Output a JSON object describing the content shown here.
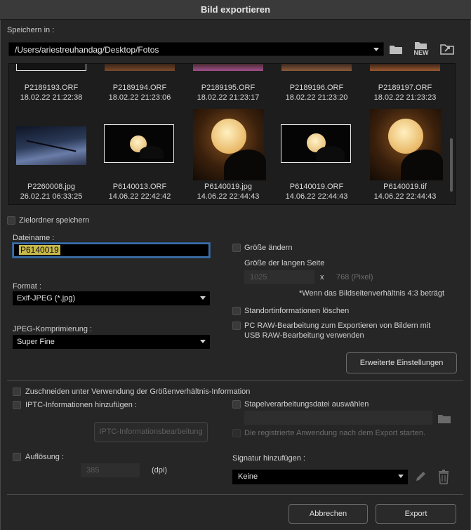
{
  "window": {
    "title": "Bild exportieren"
  },
  "save_in": {
    "label": "Speichern in :",
    "path": "/Users/ariestreuhandag/Desktop/Fotos",
    "new_label": "NEW"
  },
  "thumbnails_top": [
    {
      "name": "P2189193.ORF",
      "date": "18.02.22 21:22:38"
    },
    {
      "name": "P2189194.ORF",
      "date": "18.02.22 21:23:06"
    },
    {
      "name": "P2189195.ORF",
      "date": "18.02.22 21:23:17"
    },
    {
      "name": "P2189196.ORF",
      "date": "18.02.22 21:23:20"
    },
    {
      "name": "P2189197.ORF",
      "date": "18.02.22 21:23:23"
    }
  ],
  "thumbnails_bottom": [
    {
      "name": "P2260008.jpg",
      "date": "26.02.21 06:33:25"
    },
    {
      "name": "P6140013.ORF",
      "date": "14.06.22 22:42:42"
    },
    {
      "name": "P6140019.jpg",
      "date": "14.06.22 22:44:43"
    },
    {
      "name": "P6140019.ORF",
      "date": "14.06.22 22:44:43"
    },
    {
      "name": "P6140019.tif",
      "date": "14.06.22 22:44:43"
    }
  ],
  "save_target_folder": {
    "label": "Zielordner speichern"
  },
  "filename": {
    "label": "Dateiname :",
    "value": "P6140019"
  },
  "format": {
    "label": "Format :",
    "value": "Exif-JPEG (*.jpg)"
  },
  "jpeg_compression": {
    "label": "JPEG-Komprimierung  :",
    "value": "Super Fine"
  },
  "resize": {
    "label": "Größe ändern",
    "long_side_label": "Größe der langen Seite",
    "long_side_value": "1025",
    "x": "x",
    "short_side": "768 (Pixel)",
    "note": "*Wenn das Bildseitenverhältnis 4:3 beträgt"
  },
  "delete_location": {
    "label": "Standortinformationen löschen"
  },
  "pc_raw": {
    "line1": "PC RAW-Bearbeitung zum Exportieren von Bildern mit",
    "line2": "USB RAW-Bearbeitung verwenden"
  },
  "advanced_button": "Erweiterte Einstellungen",
  "crop": {
    "label": "Zuschneiden unter Verwendung der Größenverhältnis-Information"
  },
  "iptc": {
    "label": "IPTC-Informationen hinzufügen :",
    "button": "IPTC-Informationsbearbeitung"
  },
  "batch": {
    "label": "Stapelverarbeitungsdatei auswählen",
    "start_app": "Die registrierte Anwendung nach dem Export starten."
  },
  "resolution": {
    "label": "Auflösung :",
    "value": "385",
    "unit": "(dpi)"
  },
  "signature": {
    "label": "Signatur hinzufügen :",
    "value": "Keine"
  },
  "footer": {
    "cancel": "Abbrechen",
    "export": "Export"
  }
}
